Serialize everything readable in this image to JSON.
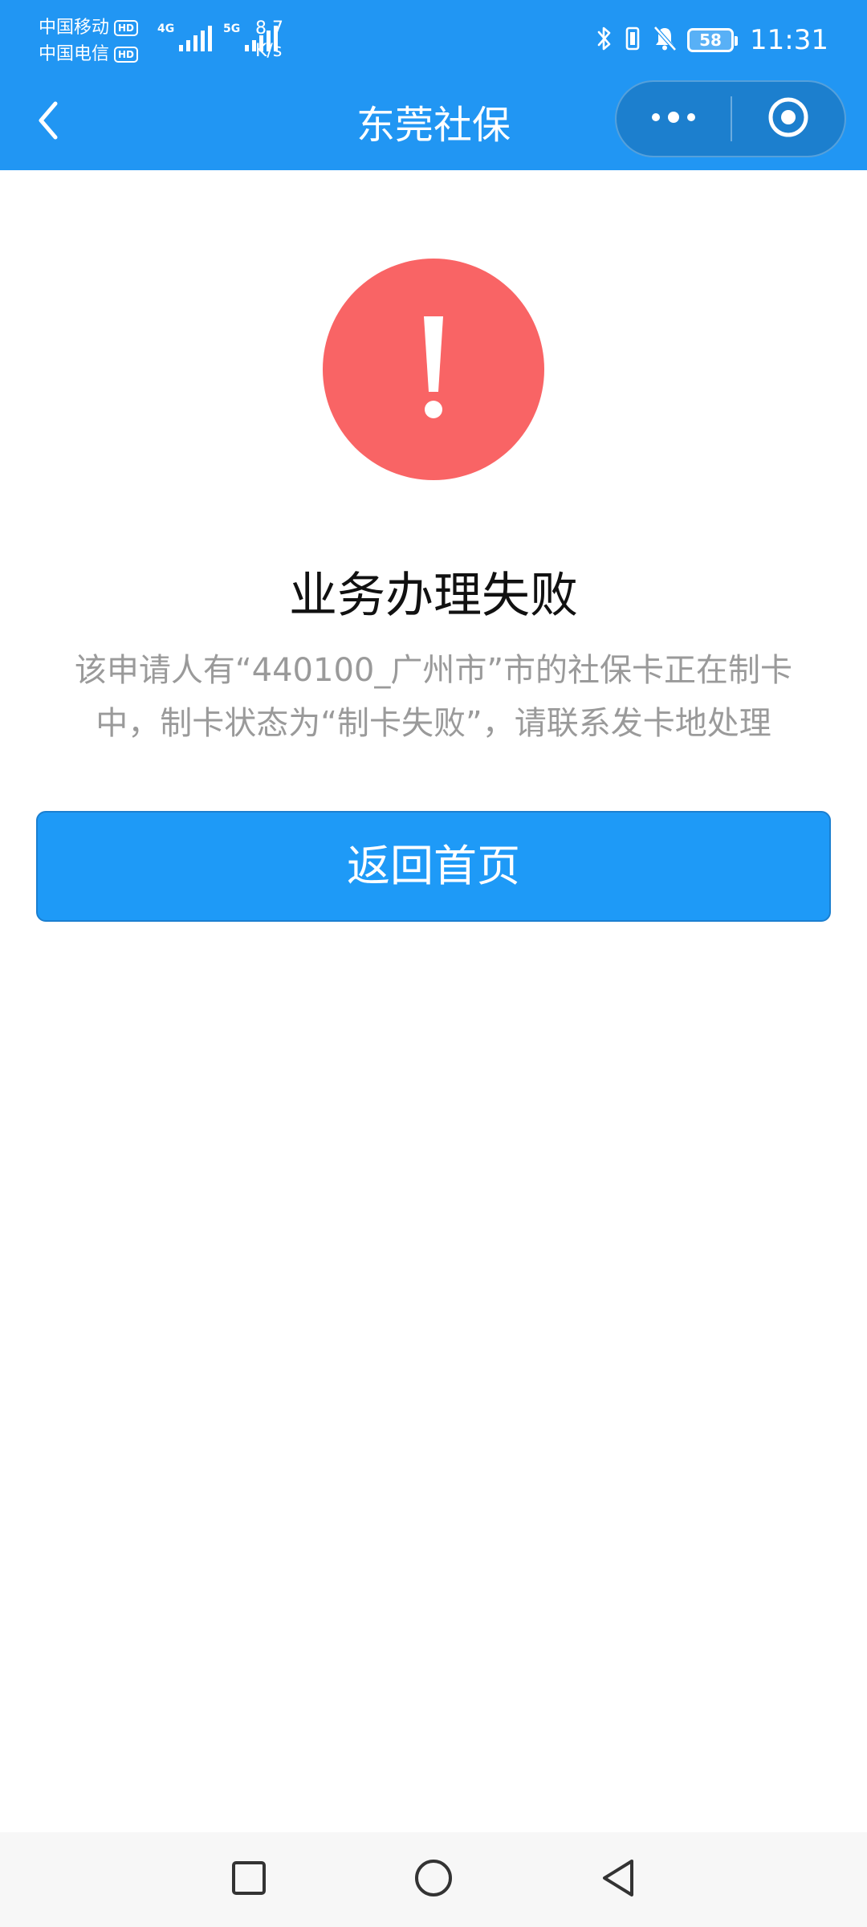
{
  "status_bar": {
    "carrier_1": "中国移动",
    "carrier_2": "中国电信",
    "hd_label": "HD",
    "net_1": "4G",
    "net_2": "5G",
    "speed_value": "8.7",
    "speed_unit": "K/s",
    "battery": "58",
    "time": "11:31",
    "icons": [
      "bluetooth-icon",
      "vibrate-icon",
      "bell-off-icon"
    ]
  },
  "nav": {
    "title": "东莞社保",
    "back_icon": "chevron-left-icon",
    "more_icon": "more-dots-icon",
    "close_icon": "target-circle-icon"
  },
  "result": {
    "icon": "exclamation-icon",
    "title": "业务办理失败",
    "description": "该申请人有“440100_广州市”市的社保卡正在制卡中，制卡状态为“制卡失败”，请联系发卡地处理"
  },
  "actions": {
    "home_label": "返回首页"
  },
  "colors": {
    "primary": "#2196f3",
    "button": "#1e9af7",
    "error": "#f96465",
    "muted_text": "#9a9a9a"
  },
  "system_nav": {
    "icons": [
      "recent-apps-icon",
      "home-circle-icon",
      "back-triangle-icon"
    ]
  }
}
